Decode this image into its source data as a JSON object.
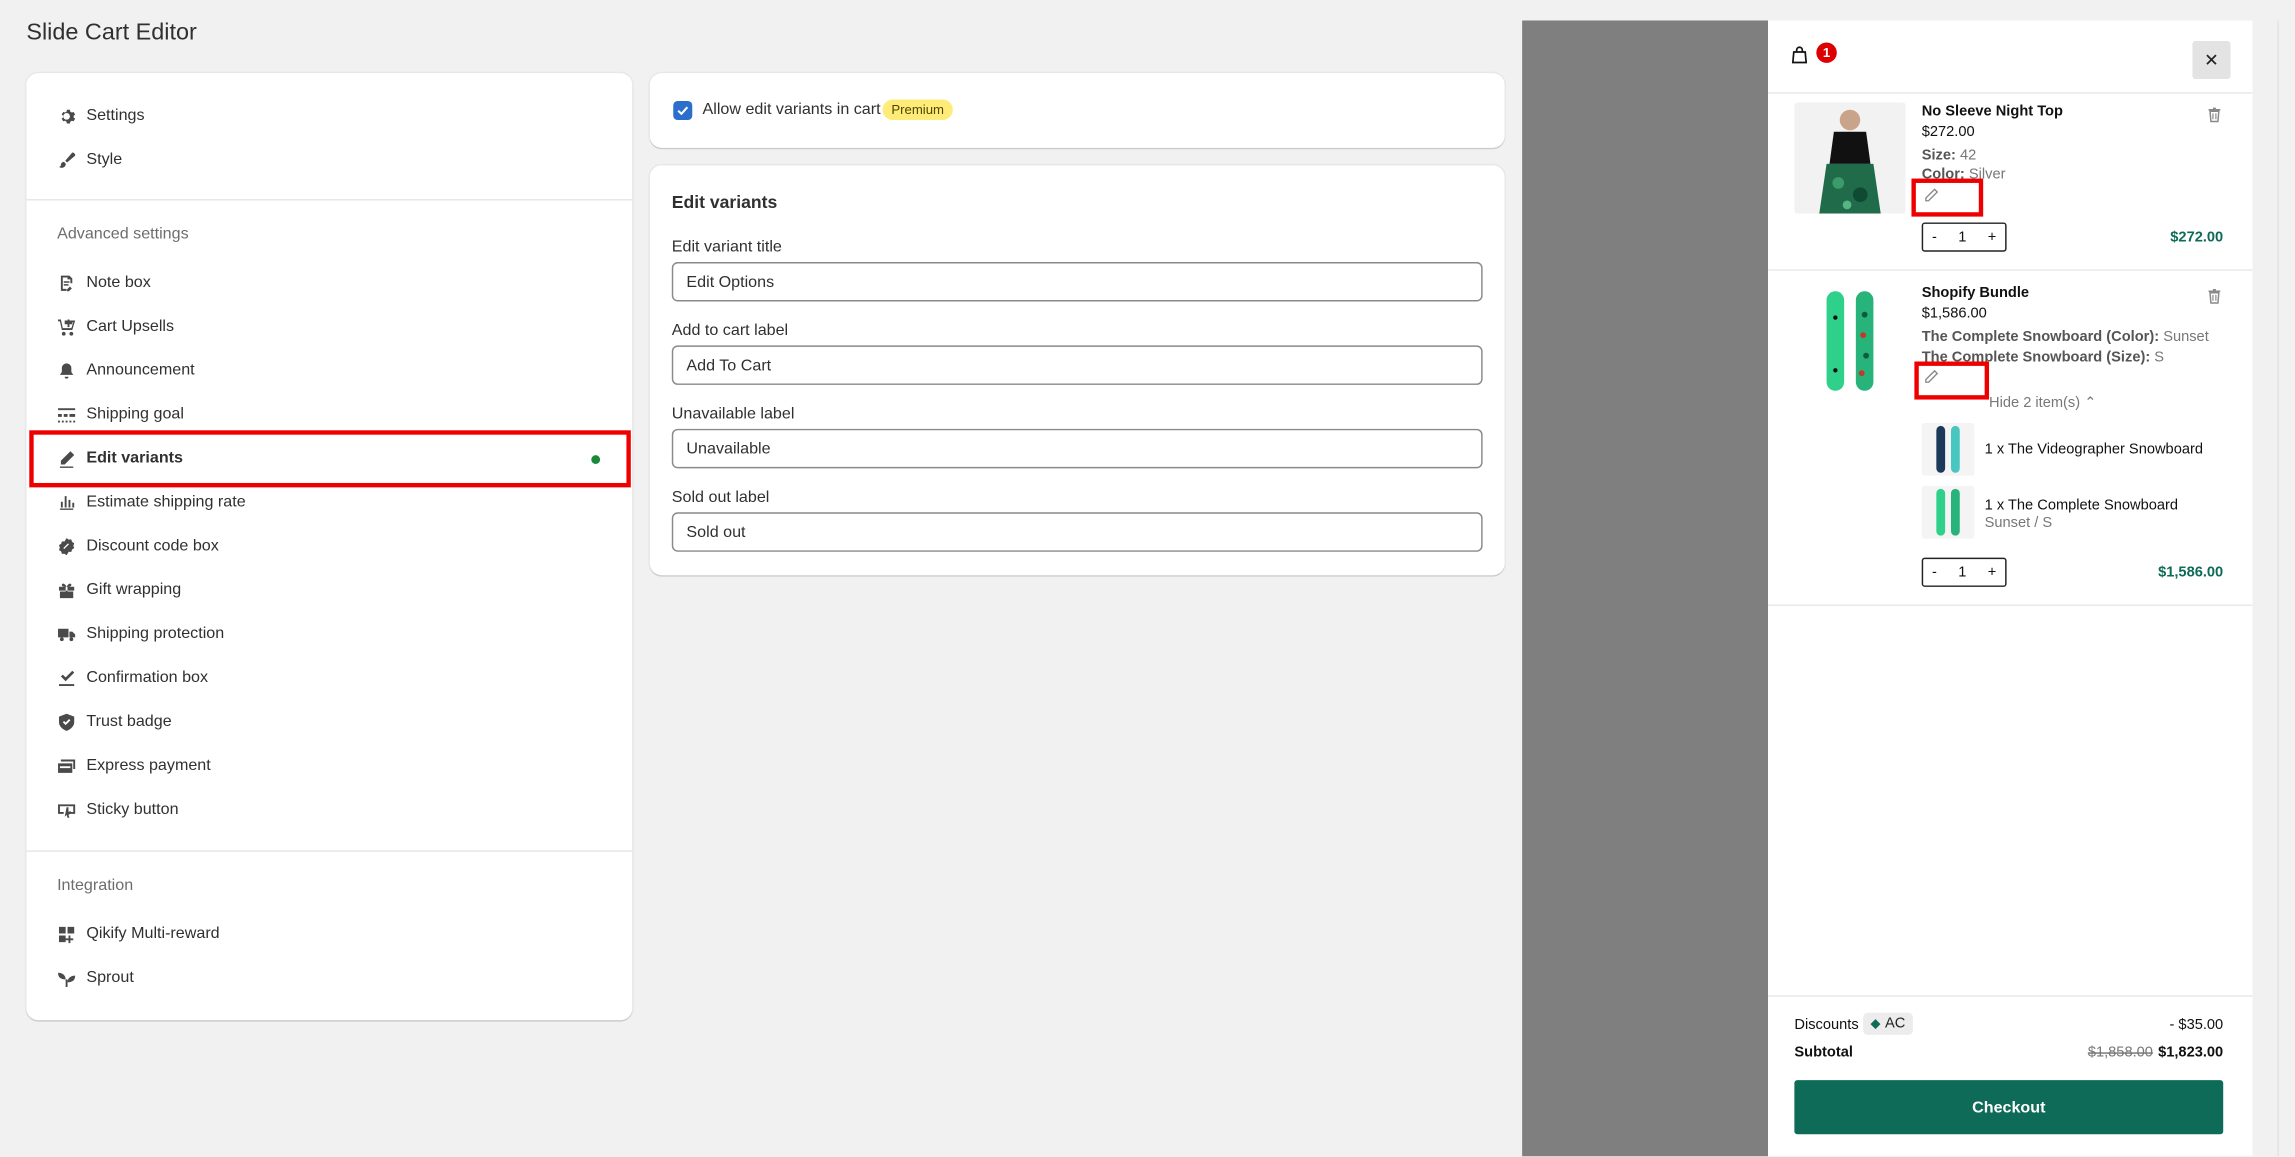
{
  "page": {
    "title": "Slide Cart Editor"
  },
  "sidebar": {
    "top_items": [
      {
        "label": "Settings",
        "icon": "gear-icon"
      },
      {
        "label": "Style",
        "icon": "brush-icon"
      }
    ],
    "advanced_label": "Advanced settings",
    "advanced_items": [
      {
        "label": "Note box",
        "icon": "note-icon"
      },
      {
        "label": "Cart Upsells",
        "icon": "cart-upsell-icon"
      },
      {
        "label": "Announcement",
        "icon": "bell-icon"
      },
      {
        "label": "Shipping goal",
        "icon": "progress-icon"
      },
      {
        "label": "Edit variants",
        "icon": "pencil-icon",
        "active": true
      },
      {
        "label": "Estimate shipping rate",
        "icon": "bar-chart-icon"
      },
      {
        "label": "Discount code box",
        "icon": "discount-icon"
      },
      {
        "label": "Gift wrapping",
        "icon": "gift-icon"
      },
      {
        "label": "Shipping protection",
        "icon": "truck-icon"
      },
      {
        "label": "Confirmation box",
        "icon": "check-box-icon"
      },
      {
        "label": "Trust badge",
        "icon": "shield-icon"
      },
      {
        "label": "Express payment",
        "icon": "card-icon"
      },
      {
        "label": "Sticky button",
        "icon": "sticky-icon"
      }
    ],
    "integration_label": "Integration",
    "integration_items": [
      {
        "label": "Qikify Multi-reward",
        "icon": "apps-icon"
      },
      {
        "label": "Sprout",
        "icon": "sprout-icon"
      }
    ],
    "active_indicator_color": "#1a8a3a"
  },
  "allow_card": {
    "checkbox_label": "Allow edit variants in cart",
    "checked": true,
    "badge": "Premium"
  },
  "edit_card": {
    "title": "Edit variants",
    "fields": [
      {
        "label": "Edit variant title",
        "value": "Edit Options"
      },
      {
        "label": "Add to cart label",
        "value": "Add To Cart"
      },
      {
        "label": "Unavailable label",
        "value": "Unavailable"
      },
      {
        "label": "Sold out label",
        "value": "Sold out"
      }
    ]
  },
  "cart": {
    "count": "1",
    "close": "✕",
    "items": [
      {
        "name": "No Sleeve Night Top",
        "price": "$272.00",
        "attrs": [
          {
            "key": "Size:",
            "value": "42"
          },
          {
            "key": "Color:",
            "value": "Silver"
          }
        ],
        "qty": "1",
        "minus": "-",
        "plus": "+",
        "total": "$272.00"
      },
      {
        "name": "Shopify Bundle",
        "price": "$1,586.00",
        "attrs": [
          {
            "key": "The Complete Snowboard (Color):",
            "value": "Sunset"
          },
          {
            "key": "The Complete Snowboard (Size):",
            "value": "S"
          }
        ],
        "hide_label": "Hide 2 item(s)",
        "sub_items": [
          {
            "label": "1 x The Videographer Snowboard",
            "variant": ""
          },
          {
            "label": "1 x The Complete Snowboard",
            "variant": "Sunset / S"
          }
        ],
        "qty": "1",
        "minus": "-",
        "plus": "+",
        "total": "$1,586.00"
      }
    ],
    "discounts_label": "Discounts",
    "discount_code": "AC",
    "discount_value": "- $35.00",
    "subtotal_label": "Subtotal",
    "subtotal_old": "$1,858.00",
    "subtotal_new": "$1,823.00",
    "checkout_label": "Checkout",
    "accent_color": "#0e6b57"
  }
}
